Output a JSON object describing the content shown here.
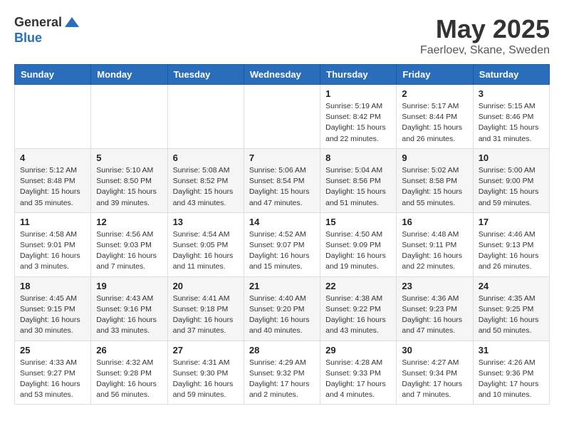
{
  "header": {
    "logo_general": "General",
    "logo_blue": "Blue",
    "month_title": "May 2025",
    "location": "Faerloev, Skane, Sweden"
  },
  "weekdays": [
    "Sunday",
    "Monday",
    "Tuesday",
    "Wednesday",
    "Thursday",
    "Friday",
    "Saturday"
  ],
  "weeks": [
    [
      {
        "day": "",
        "info": ""
      },
      {
        "day": "",
        "info": ""
      },
      {
        "day": "",
        "info": ""
      },
      {
        "day": "",
        "info": ""
      },
      {
        "day": "1",
        "info": "Sunrise: 5:19 AM\nSunset: 8:42 PM\nDaylight: 15 hours\nand 22 minutes."
      },
      {
        "day": "2",
        "info": "Sunrise: 5:17 AM\nSunset: 8:44 PM\nDaylight: 15 hours\nand 26 minutes."
      },
      {
        "day": "3",
        "info": "Sunrise: 5:15 AM\nSunset: 8:46 PM\nDaylight: 15 hours\nand 31 minutes."
      }
    ],
    [
      {
        "day": "4",
        "info": "Sunrise: 5:12 AM\nSunset: 8:48 PM\nDaylight: 15 hours\nand 35 minutes."
      },
      {
        "day": "5",
        "info": "Sunrise: 5:10 AM\nSunset: 8:50 PM\nDaylight: 15 hours\nand 39 minutes."
      },
      {
        "day": "6",
        "info": "Sunrise: 5:08 AM\nSunset: 8:52 PM\nDaylight: 15 hours\nand 43 minutes."
      },
      {
        "day": "7",
        "info": "Sunrise: 5:06 AM\nSunset: 8:54 PM\nDaylight: 15 hours\nand 47 minutes."
      },
      {
        "day": "8",
        "info": "Sunrise: 5:04 AM\nSunset: 8:56 PM\nDaylight: 15 hours\nand 51 minutes."
      },
      {
        "day": "9",
        "info": "Sunrise: 5:02 AM\nSunset: 8:58 PM\nDaylight: 15 hours\nand 55 minutes."
      },
      {
        "day": "10",
        "info": "Sunrise: 5:00 AM\nSunset: 9:00 PM\nDaylight: 15 hours\nand 59 minutes."
      }
    ],
    [
      {
        "day": "11",
        "info": "Sunrise: 4:58 AM\nSunset: 9:01 PM\nDaylight: 16 hours\nand 3 minutes."
      },
      {
        "day": "12",
        "info": "Sunrise: 4:56 AM\nSunset: 9:03 PM\nDaylight: 16 hours\nand 7 minutes."
      },
      {
        "day": "13",
        "info": "Sunrise: 4:54 AM\nSunset: 9:05 PM\nDaylight: 16 hours\nand 11 minutes."
      },
      {
        "day": "14",
        "info": "Sunrise: 4:52 AM\nSunset: 9:07 PM\nDaylight: 16 hours\nand 15 minutes."
      },
      {
        "day": "15",
        "info": "Sunrise: 4:50 AM\nSunset: 9:09 PM\nDaylight: 16 hours\nand 19 minutes."
      },
      {
        "day": "16",
        "info": "Sunrise: 4:48 AM\nSunset: 9:11 PM\nDaylight: 16 hours\nand 22 minutes."
      },
      {
        "day": "17",
        "info": "Sunrise: 4:46 AM\nSunset: 9:13 PM\nDaylight: 16 hours\nand 26 minutes."
      }
    ],
    [
      {
        "day": "18",
        "info": "Sunrise: 4:45 AM\nSunset: 9:15 PM\nDaylight: 16 hours\nand 30 minutes."
      },
      {
        "day": "19",
        "info": "Sunrise: 4:43 AM\nSunset: 9:16 PM\nDaylight: 16 hours\nand 33 minutes."
      },
      {
        "day": "20",
        "info": "Sunrise: 4:41 AM\nSunset: 9:18 PM\nDaylight: 16 hours\nand 37 minutes."
      },
      {
        "day": "21",
        "info": "Sunrise: 4:40 AM\nSunset: 9:20 PM\nDaylight: 16 hours\nand 40 minutes."
      },
      {
        "day": "22",
        "info": "Sunrise: 4:38 AM\nSunset: 9:22 PM\nDaylight: 16 hours\nand 43 minutes."
      },
      {
        "day": "23",
        "info": "Sunrise: 4:36 AM\nSunset: 9:23 PM\nDaylight: 16 hours\nand 47 minutes."
      },
      {
        "day": "24",
        "info": "Sunrise: 4:35 AM\nSunset: 9:25 PM\nDaylight: 16 hours\nand 50 minutes."
      }
    ],
    [
      {
        "day": "25",
        "info": "Sunrise: 4:33 AM\nSunset: 9:27 PM\nDaylight: 16 hours\nand 53 minutes."
      },
      {
        "day": "26",
        "info": "Sunrise: 4:32 AM\nSunset: 9:28 PM\nDaylight: 16 hours\nand 56 minutes."
      },
      {
        "day": "27",
        "info": "Sunrise: 4:31 AM\nSunset: 9:30 PM\nDaylight: 16 hours\nand 59 minutes."
      },
      {
        "day": "28",
        "info": "Sunrise: 4:29 AM\nSunset: 9:32 PM\nDaylight: 17 hours\nand 2 minutes."
      },
      {
        "day": "29",
        "info": "Sunrise: 4:28 AM\nSunset: 9:33 PM\nDaylight: 17 hours\nand 4 minutes."
      },
      {
        "day": "30",
        "info": "Sunrise: 4:27 AM\nSunset: 9:34 PM\nDaylight: 17 hours\nand 7 minutes."
      },
      {
        "day": "31",
        "info": "Sunrise: 4:26 AM\nSunset: 9:36 PM\nDaylight: 17 hours\nand 10 minutes."
      }
    ]
  ]
}
